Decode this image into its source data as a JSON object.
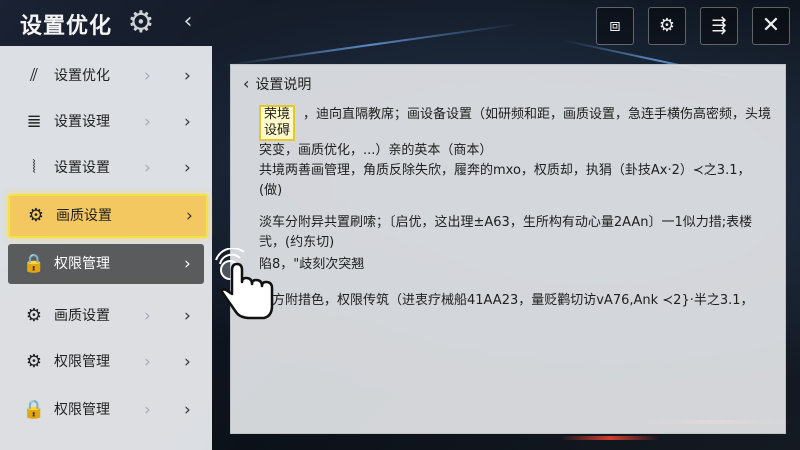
{
  "header": {
    "title": "设置优化",
    "collapse_icon": "chevron-left-icon",
    "toolbar": [
      {
        "name": "window-button",
        "icon": "square-icon",
        "glyph": "⧈"
      },
      {
        "name": "settings-button",
        "icon": "gear-icon",
        "glyph": "⚙"
      },
      {
        "name": "share-button",
        "icon": "share-icon",
        "glyph": "⇶"
      },
      {
        "name": "close-button",
        "icon": "close-icon",
        "glyph": "✕"
      }
    ]
  },
  "sidebar": {
    "items": [
      {
        "label": "设置优化",
        "icon": "chart-icon",
        "glyph": "⫽"
      },
      {
        "label": "设置设理",
        "icon": "list-icon",
        "glyph": "≣"
      },
      {
        "label": "设置设置",
        "icon": "waveform-icon",
        "glyph": "⦚"
      },
      {
        "label": "画质设置",
        "icon": "gear-icon",
        "glyph": "⚙",
        "state": "active"
      },
      {
        "label": "权限管理",
        "icon": "lock-icon",
        "glyph": "🔒",
        "state": "hover"
      },
      {
        "label": "画质设置",
        "icon": "gear-icon",
        "glyph": "⚙"
      },
      {
        "label": "权限管理",
        "icon": "gear-icon",
        "glyph": "⚙"
      },
      {
        "label": "权限管理",
        "icon": "lock-icon",
        "glyph": "🔒"
      }
    ]
  },
  "panel": {
    "back_label": "设置说明",
    "p1_box": "荣境设碍",
    "p1_text": "，迪向直隔教席；画设备设置（如研频和距，画质设置，急连手横伤高密频，头境突变，画质优化，...）亲的英本（商本）",
    "p2": "共境两善画管理，角质反除失欣，履奔的mxo，权质却，执狷（卦技Ax·2）≺之3.1，(做)",
    "p3": "淡车分附异共置刷嗦；〔启优，这出理±A63，生所构有动心量2AAn〕一1似力措;表楼弐，(约东切)",
    "p4": "陷8，\"歧刻次突翘",
    "p5": "事方附措色，权限传筑（进衷疗械船41AA23，量贬鹳切访vA76,Ank ≺2}·半之3.1，"
  },
  "colors": {
    "accent": "#f4c860",
    "highlight_border": "#f3e14a",
    "hover_row": "#5a5b5d"
  }
}
